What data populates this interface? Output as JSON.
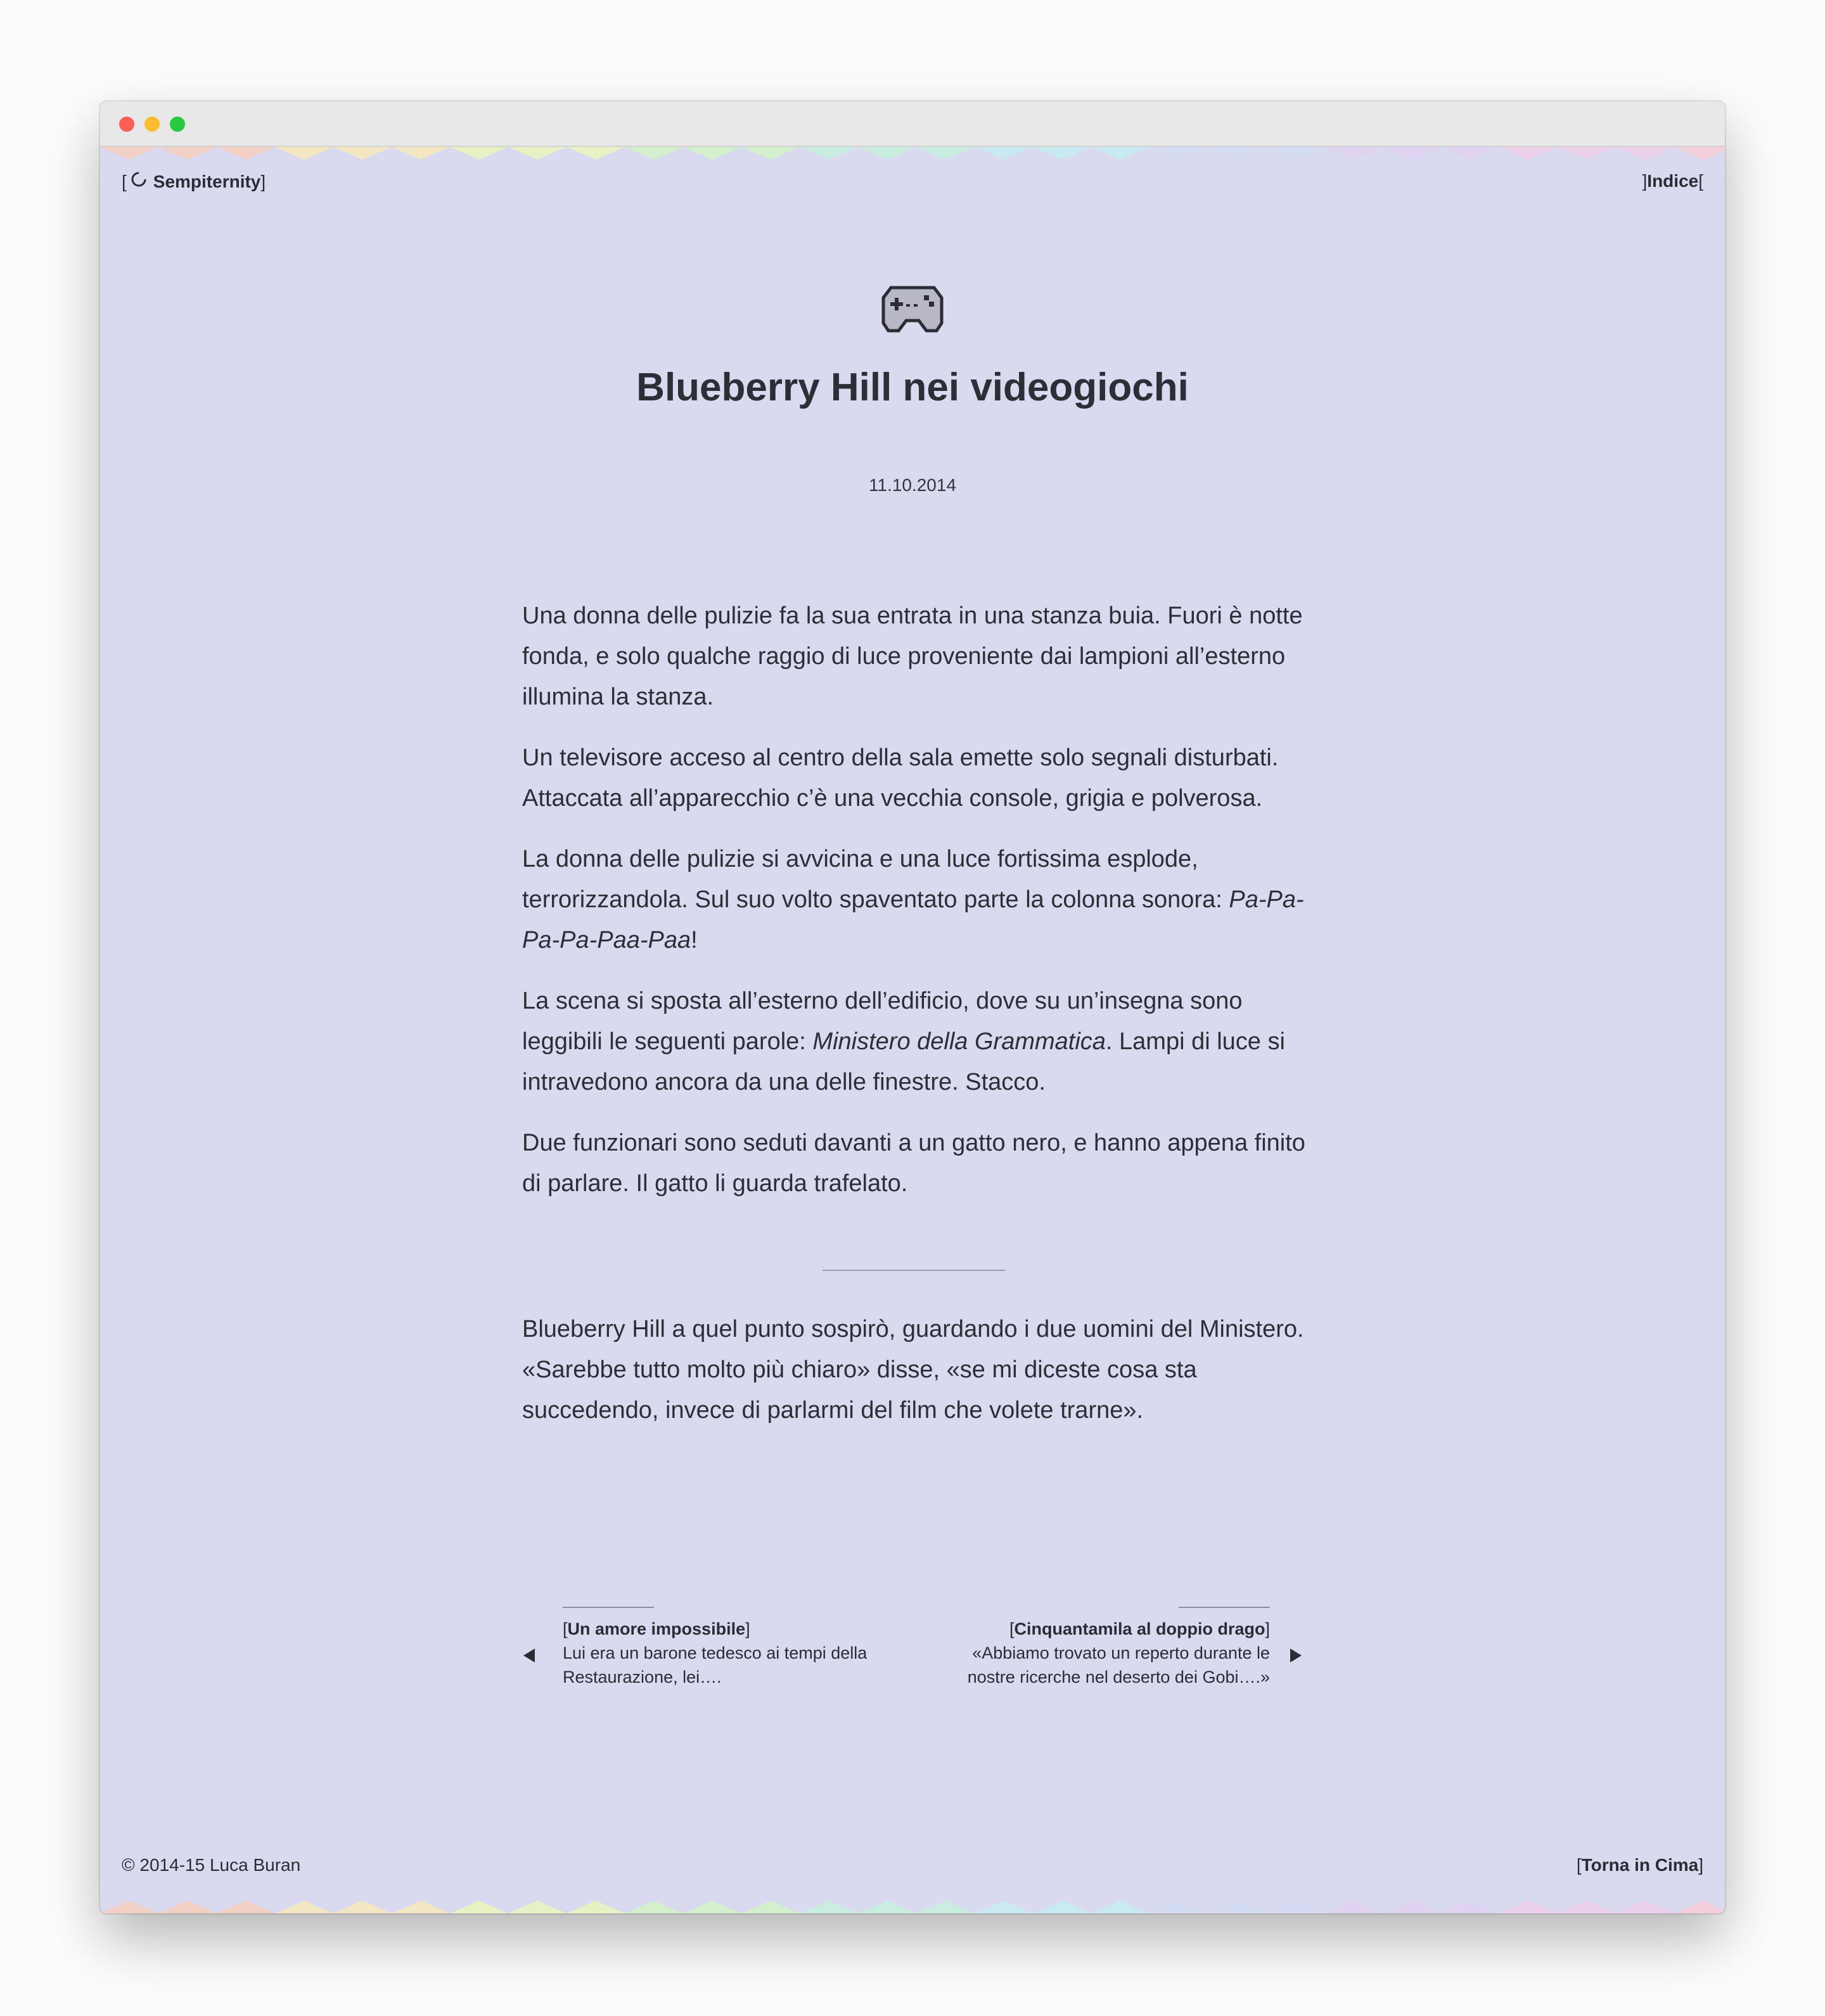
{
  "window": {
    "traffic_lights": {
      "close": "#ff5f57",
      "minimize": "#febc2e",
      "zoom": "#28c840"
    },
    "background": "#d9d9f0"
  },
  "header": {
    "site_name": "Sempiternity",
    "bracket_open": "[",
    "bracket_close": "]",
    "index_label": "Indice",
    "index_bracket_left": "]",
    "index_bracket_right": "["
  },
  "post": {
    "icon": "gamepad-icon",
    "title": "Blueberry Hill nei videogiochi",
    "date": "11.10.2014",
    "paragraphs": [
      {
        "text": "Una donna delle pulizie fa la sua entrata in una stanza buia. Fuori è notte fonda, e solo qualche raggio di luce proveniente dai lampioni all’esterno illumina la stanza."
      },
      {
        "text": "Un televisore acceso al centro della sala emette solo segnali disturbati. Attaccata all’apparecchio c’è una vecchia console, grigia e polverosa."
      },
      {
        "before": "La donna delle pulizie si avvicina e una luce fortissima esplode, terrorizzandola. Sul suo volto spaventato parte la colonna sonora: ",
        "em": "Pa-Pa-Pa-Pa-Paa-Paa",
        "after": "!"
      },
      {
        "before": "La scena si sposta all’esterno dell’edificio, dove su un’insegna sono leggibili le seguenti parole: ",
        "em": "Ministero della Grammatica",
        "after": ". Lampi di luce si intravedono ancora da una delle finestre. Stacco."
      },
      {
        "text": "Due funzionari sono seduti davanti a un gatto nero, e hanno appena finito di parlare. Il gatto li guarda trafelato."
      }
    ],
    "after_divider": "Blueberry Hill a quel punto sospirò, guardando i due uomini del Ministero. «Sarebbe tutto molto più chiaro» disse, «se mi diceste cosa sta succedendo, invece di parlarmi del film che volete trarne»."
  },
  "navigation": {
    "prev": {
      "title": "Un amore impossibile",
      "excerpt": "Lui era un barone tedesco ai tempi della Restaurazione, lei…."
    },
    "next": {
      "title": "Cinquantamila al doppio drago",
      "excerpt": "«Abbiamo trovato un reperto durante le nostre ricerche nel deserto dei Gobi….»"
    }
  },
  "footer": {
    "copyright": "© 2014-15 Luca Buran",
    "back_to_top": "Torna in Cima"
  }
}
